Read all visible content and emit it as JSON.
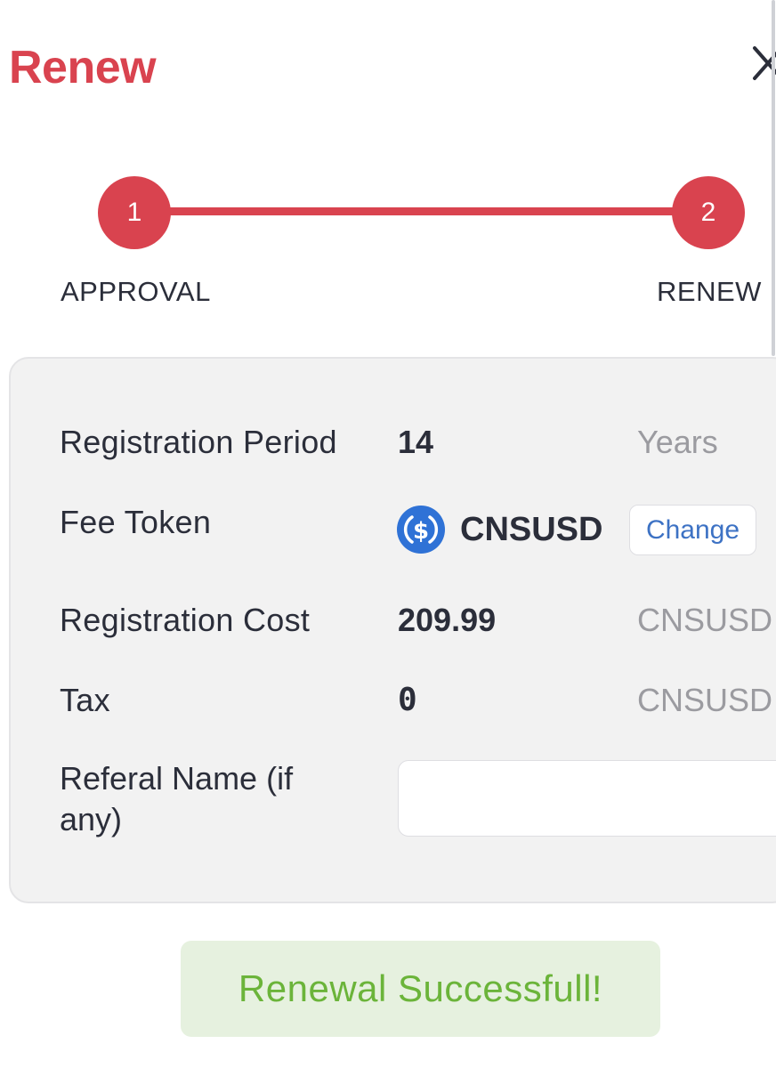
{
  "header": {
    "title": "Renew",
    "close_icon": "close-icon"
  },
  "stepper": {
    "steps": [
      {
        "number": "1",
        "label": "APPROVAL"
      },
      {
        "number": "2",
        "label": "RENEW"
      }
    ],
    "accent_color": "#d9434f"
  },
  "details": {
    "registration_period": {
      "label": "Registration Period",
      "value": "14",
      "unit": "Years"
    },
    "fee_token": {
      "label": "Fee Token",
      "token": "CNSUSD",
      "icon": "usdc-dollar-icon",
      "change_label": "Change"
    },
    "registration_cost": {
      "label": "Registration Cost",
      "value": "209.99",
      "unit": "CNSUSD"
    },
    "tax": {
      "label": "Tax",
      "value": "0",
      "unit": "CNSUSD"
    },
    "referral": {
      "label": "Referal Name (if any)",
      "value": "",
      "placeholder": ""
    }
  },
  "status": {
    "message": "Renewal Successfull!",
    "color": "#6bb43a"
  }
}
